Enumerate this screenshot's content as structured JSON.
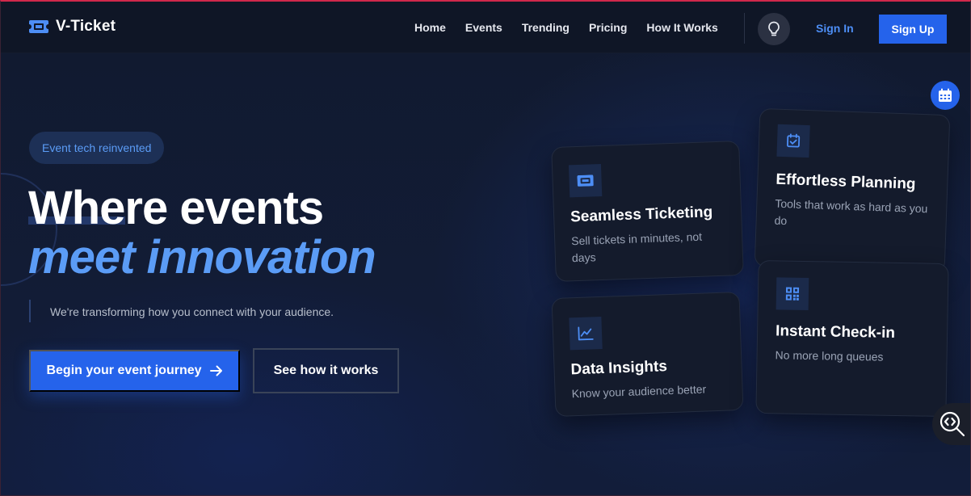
{
  "brand": {
    "name": "V-Ticket",
    "icon": "ticket-icon"
  },
  "nav": {
    "links": [
      {
        "label": "Home"
      },
      {
        "label": "Events"
      },
      {
        "label": "Trending"
      },
      {
        "label": "Pricing"
      },
      {
        "label": "How It Works"
      }
    ],
    "theme_icon": "lightbulb-icon",
    "sign_in": "Sign In",
    "sign_up": "Sign Up"
  },
  "hero": {
    "badge": "Event tech reinvented",
    "headline_line1": "Where events",
    "headline_line2": "meet innovation",
    "subtitle": "We're transforming how you connect with your audience.",
    "primary_cta": "Begin your event journey",
    "primary_cta_icon": "arrow-right-icon",
    "secondary_cta": "See how it works"
  },
  "features": [
    {
      "icon": "ticket-icon",
      "title": "Seamless Ticketing",
      "description": "Sell tickets in minutes, not days"
    },
    {
      "icon": "calendar-check-icon",
      "title": "Effortless Planning",
      "description": "Tools that work as hard as you do"
    },
    {
      "icon": "chart-line-icon",
      "title": "Data Insights",
      "description": "Know your audience better"
    },
    {
      "icon": "qr-code-icon",
      "title": "Instant Check-in",
      "description": "No more long queues"
    }
  ],
  "floating": {
    "calendar_icon": "calendar-icon",
    "inspect_icon": "code-search-icon"
  },
  "colors": {
    "accent": "#2563eb",
    "accent_light": "#5b9cf6",
    "background": "#0e1526",
    "card": "#141b2c"
  }
}
